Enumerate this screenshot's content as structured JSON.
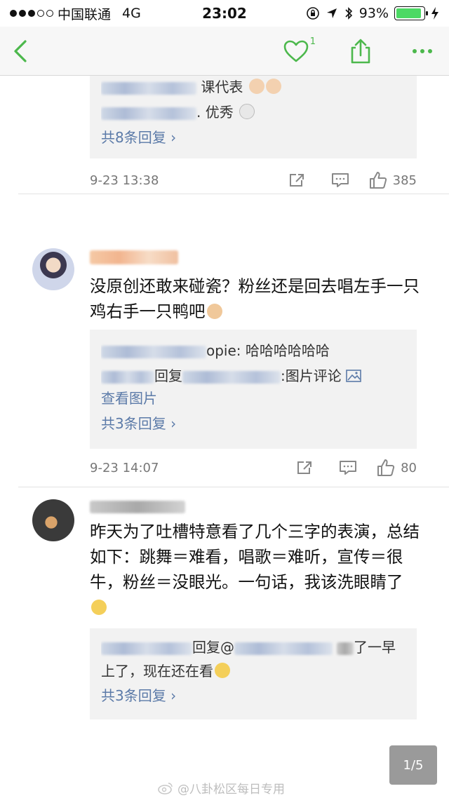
{
  "status_bar": {
    "carrier": "中国联通",
    "network": "4G",
    "time": "23:02",
    "battery_text": "93%",
    "battery_level": 0.93
  },
  "nav": {
    "like_count": "1",
    "icons": [
      "back-icon",
      "heart-icon",
      "share-icon",
      "more-icon"
    ]
  },
  "colors": {
    "accent_green": "#4cb84c",
    "link_blue": "#5b7aa8",
    "reply_bg": "#f2f2f2"
  },
  "comment0": {
    "replies": [
      {
        "text": "课代表"
      },
      {
        "text": ". 优秀"
      }
    ],
    "more_replies": "共8条回复",
    "date": "9-23 13:38",
    "likes": "385"
  },
  "comment1": {
    "text": "没原创还敢来碰瓷？粉丝还是回去唱左手一只鸡右手一只鸭吧",
    "replies": [
      {
        "suffix": "opie: 哈哈哈哈哈哈"
      },
      {
        "mid": "回复",
        "suffix": ":图片评论",
        "link": "查看图片"
      }
    ],
    "more_replies": "共3条回复",
    "date": "9-23 14:07",
    "likes": "80"
  },
  "comment2": {
    "text": "昨天为了吐槽特意看了几个三字的表演，总结如下：跳舞＝难看，唱歌＝难听，宣传＝很牛，粉丝＝没眼光。一句话，我该洗眼睛了",
    "reply": {
      "mid": "回复@",
      "suffix": "了一早上了，现在还在看"
    },
    "more_replies": "共3条回复"
  },
  "page_indicator": "1/5",
  "watermark": "@八卦松区每日专用"
}
